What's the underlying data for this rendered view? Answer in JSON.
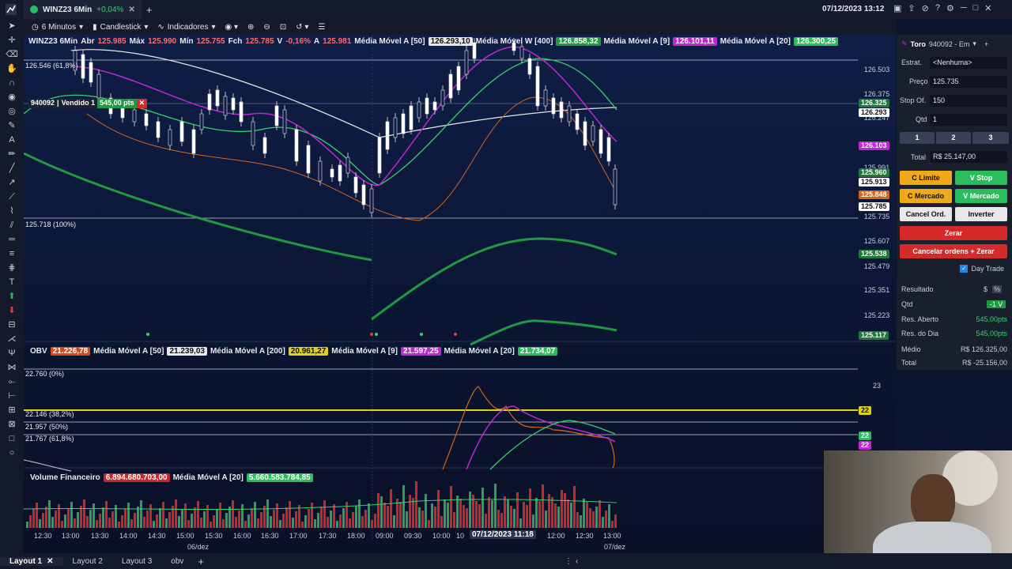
{
  "window": {
    "tab_title": "WINZ23 6Min",
    "tab_change": "+0,04%",
    "datetime": "07/12/2023 13:12"
  },
  "toolbar": {
    "interval": "6 Minutos",
    "chart_type": "Candlestick",
    "indicators": "Indicadores"
  },
  "main_legend": {
    "symbol": "WINZ23 6Min",
    "abr_label": "Abr",
    "abr": "125.985",
    "max_label": "Máx",
    "max": "125.990",
    "min_label": "Mín",
    "min": "125.755",
    "fch_label": "Fch",
    "fch": "125.785",
    "var_label": "V",
    "var": "-0,16%",
    "a_label": "A",
    "a": "125.981",
    "ma1_label": "Média Móvel A [50]",
    "ma1_val": "126.293,10",
    "ma2_label": "Média Móvel W [400]",
    "ma2_val": "126.858,32",
    "ma3_label": "Média Móvel A [9]",
    "ma3_val": "126.101,11",
    "ma4_label": "Média Móvel A [20]",
    "ma4_val": "126.300,25"
  },
  "fib_levels": {
    "top": "126.546 (61,8%)",
    "bottom": "125.718 (100%)"
  },
  "position_tag": {
    "account": "940092",
    "side": "Vendido 1",
    "pts": "545,00 pts"
  },
  "price_axis": [
    "126.503",
    "126.375",
    "126.247",
    "125.991",
    "125.735",
    "125.607",
    "125.479",
    "125.351",
    "125.223"
  ],
  "price_tags": [
    {
      "val": "126.325",
      "color": "#1f7a3a"
    },
    {
      "val": "126.293",
      "color": "#ffffff"
    },
    {
      "val": "126.103",
      "color": "#c026d3"
    },
    {
      "val": "125.960",
      "color": "#1f7a3a"
    },
    {
      "val": "125.913",
      "color": "#ffffff"
    },
    {
      "val": "125.848",
      "color": "#d4661b"
    },
    {
      "val": "125.785",
      "color": "#ffffff"
    },
    {
      "val": "125.538",
      "color": "#1f7a3a"
    },
    {
      "val": "125.117",
      "color": "#1f7a3a"
    }
  ],
  "obv_legend": {
    "label": "OBV",
    "val": "21.226,78",
    "ma1_label": "Média Móvel A [50]",
    "ma1_val": "21.239,03",
    "ma2_label": "Média Móvel A [200]",
    "ma2_val": "20.961,27",
    "ma3_label": "Média Móvel A [9]",
    "ma3_val": "21.597,25",
    "ma4_label": "Média Móvel A [20]",
    "ma4_val": "21.734,07"
  },
  "obv_fib": {
    "l0": "22.760 (0%)",
    "l1": "22.146 (38,2%)",
    "l2": "21.957 (50%)",
    "l3": "21.767 (61,8%)"
  },
  "obv_axis": {
    "top": "23",
    "tag1": "22",
    "tag2": "22",
    "tag3": "22"
  },
  "volume_legend": {
    "label": "Volume Financeiro",
    "val": "6.894.680.703,00",
    "ma_label": "Média Móvel A [20]",
    "ma_val": "5.660.583.784,85"
  },
  "time_axis": [
    "12:30",
    "13:00",
    "13:30",
    "14:00",
    "14:30",
    "15:00",
    "15:30",
    "16:00",
    "16:30",
    "17:00",
    "17:30",
    "18:00",
    "09:00",
    "09:30",
    "10:00",
    "10",
    "12:00",
    "12:30",
    "13:00"
  ],
  "time_cursor": "07/12/2023 11:18",
  "date_labels": {
    "d1": "06/dez",
    "d2": "07/dez"
  },
  "order_panel": {
    "broker": "Toro",
    "account": "940092 - Em",
    "estrat_label": "Estrat.",
    "estrat": "<Nenhuma>",
    "preco_label": "Preço",
    "preco": "125.735",
    "stop_label": "Stop Of.",
    "stop": "150",
    "qtd_label": "Qtd",
    "qtd": "1",
    "q1": "1",
    "q2": "2",
    "q3": "3",
    "total_label": "Total",
    "total": "R$ 25.147,00",
    "c_limite": "C Limite",
    "v_stop": "V Stop",
    "c_mercado": "C Mercado",
    "v_mercado": "V Mercado",
    "cancel_ord": "Cancel Ord.",
    "inverter": "Inverter",
    "zerar": "Zerar",
    "cancelar_zerar": "Cancelar ordens + Zerar",
    "day_trade": "Day Trade",
    "resultado": "Resultado",
    "currency": "$",
    "pct": "%",
    "r_qtd_label": "Qtd",
    "r_qtd": "-1 V",
    "res_aberto_label": "Res. Aberto",
    "res_aberto": "545,00pts",
    "res_dia_label": "Res. do Dia",
    "res_dia": "545,00pts",
    "medio_label": "Médio",
    "medio": "R$ 126.325,00",
    "total2_label": "Total",
    "total2": "R$ -25.156,00"
  },
  "layouts": [
    "Layout 1",
    "Layout 2",
    "Layout 3",
    "obv"
  ]
}
